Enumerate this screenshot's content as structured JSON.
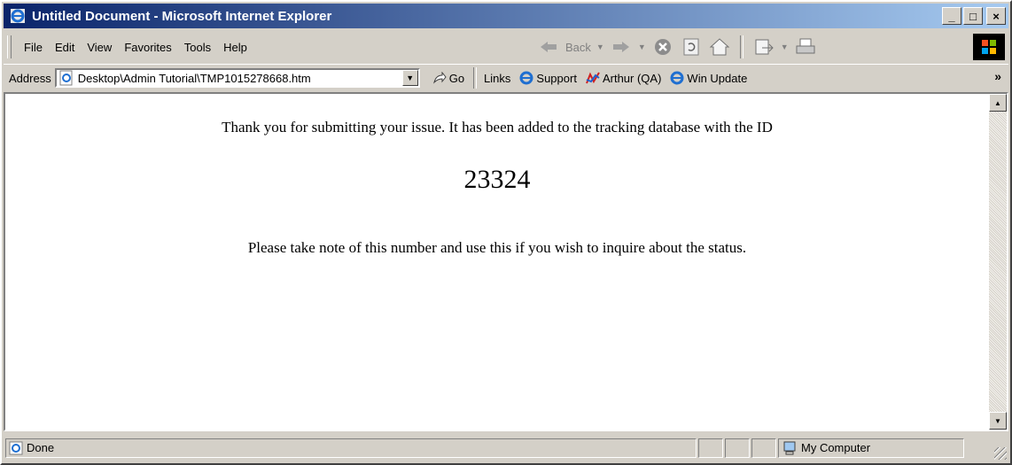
{
  "window": {
    "title": "Untitled Document - Microsoft Internet Explorer",
    "controls": {
      "minimize": "_",
      "maximize": "□",
      "close": "×"
    }
  },
  "menu": [
    "File",
    "Edit",
    "View",
    "Favorites",
    "Tools",
    "Help"
  ],
  "toolbar": {
    "back_label": "Back"
  },
  "address": {
    "label": "Address",
    "value": "Desktop\\Admin Tutorial\\TMP1015278668.htm",
    "go_label": "Go"
  },
  "links": {
    "label": "Links",
    "items": [
      "Support",
      "Arthur (QA)",
      "Win Update"
    ],
    "more": "»"
  },
  "content": {
    "message_line1": "Thank you for submitting your issue. It has been added to the tracking database with the ID",
    "issue_id": "23324",
    "message_line2": "Please take note of this number and use this if you wish to inquire about the status."
  },
  "status": {
    "text": "Done",
    "zone": "My Computer"
  }
}
